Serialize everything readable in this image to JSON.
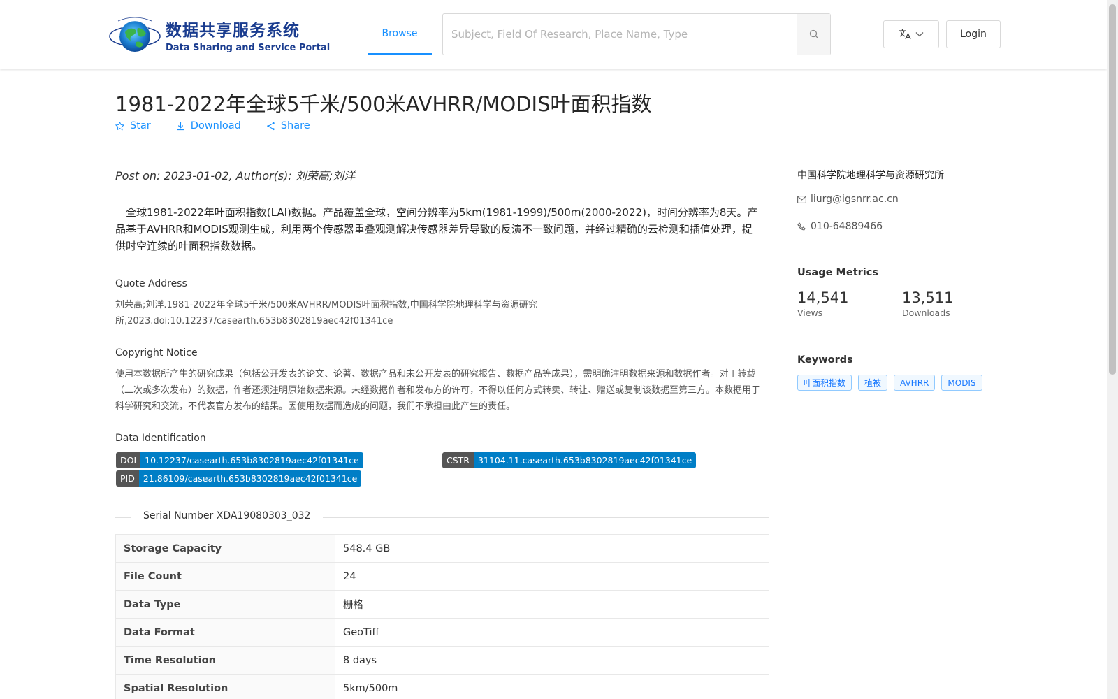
{
  "header": {
    "logo_cn": "数据共享服务系统",
    "logo_en": "Data Sharing and Service Portal",
    "nav_browse": "Browse",
    "search_placeholder": "Subject, Field Of Research, Place Name, Type",
    "login": "Login"
  },
  "dataset": {
    "title": "1981-2022年全球5千米/500米AVHRR/MODIS叶面积指数",
    "actions": {
      "star": "Star",
      "download": "Download",
      "share": "Share"
    },
    "post_on": "Post on: 2023-01-02, Author(s): 刘荣高;刘洋",
    "description": "全球1981-2022年叶面积指数(LAI)数据。产品覆盖全球，空间分辨率为5km(1981-1999)/500m(2000-2022)，时间分辨率为8天。产品基于AVHRR和MODIS观测生成，利用两个传感器重叠观测解决传感器差异导致的反演不一致问题，并经过精确的云检测和插值处理，提供时空连续的叶面积指数数据。",
    "quote_title": "Quote Address",
    "quote_text": "刘荣高;刘洋.1981-2022年全球5千米/500米AVHRR/MODIS叶面积指数,中国科学院地理科学与资源研究所,2023.doi:10.12237/casearth.653b8302819aec42f01341ce",
    "copyright_title": "Copyright Notice",
    "copyright_text": "使用本数据所产生的研究成果（包括公开发表的论文、论著、数据产品和未公开发表的研究报告、数据产品等成果），需明确注明数据来源和数据作者。对于转载（二次或多次发布）的数据，作者还须注明原始数据来源。未经数据作者和发布方的许可，不得以任何方式转卖、转让、赠送或复制该数据至第三方。本数据用于科学研究和交流，不代表官方发布的结果。因使用数据而造成的问题，我们不承担由此产生的责任。",
    "ident_title": "Data Identification",
    "identifiers": {
      "doi_key": "DOI",
      "doi_val": "10.12237/casearth.653b8302819aec42f01341ce",
      "cstr_key": "CSTR",
      "cstr_val": "31104.11.casearth.653b8302819aec42f01341ce",
      "pid_key": "PID",
      "pid_val": "21.86109/casearth.653b8302819aec42f01341ce"
    },
    "serial_number": "Serial Number XDA19080303_032",
    "properties": [
      {
        "key": "Storage Capacity",
        "value": "548.4 GB"
      },
      {
        "key": "File Count",
        "value": "24"
      },
      {
        "key": "Data Type",
        "value": "栅格"
      },
      {
        "key": "Data Format",
        "value": "GeoTiff"
      },
      {
        "key": "Time Resolution",
        "value": "8 days"
      },
      {
        "key": "Spatial Resolution",
        "value": "5km/500m"
      }
    ]
  },
  "sidebar": {
    "organization": "中国科学院地理科学与资源研究所",
    "email": "liurg@igsnrr.ac.cn",
    "phone": "010-64889466",
    "usage_title": "Usage Metrics",
    "views_num": "14,541",
    "views_label": "Views",
    "downloads_num": "13,511",
    "downloads_label": "Downloads",
    "keywords_title": "Keywords",
    "keywords": [
      "叶面积指数",
      "植被",
      "AVHRR",
      "MODIS"
    ]
  },
  "colors": {
    "accent": "#1890ff",
    "badge_key": "#555555",
    "badge_val": "#007ec6"
  }
}
